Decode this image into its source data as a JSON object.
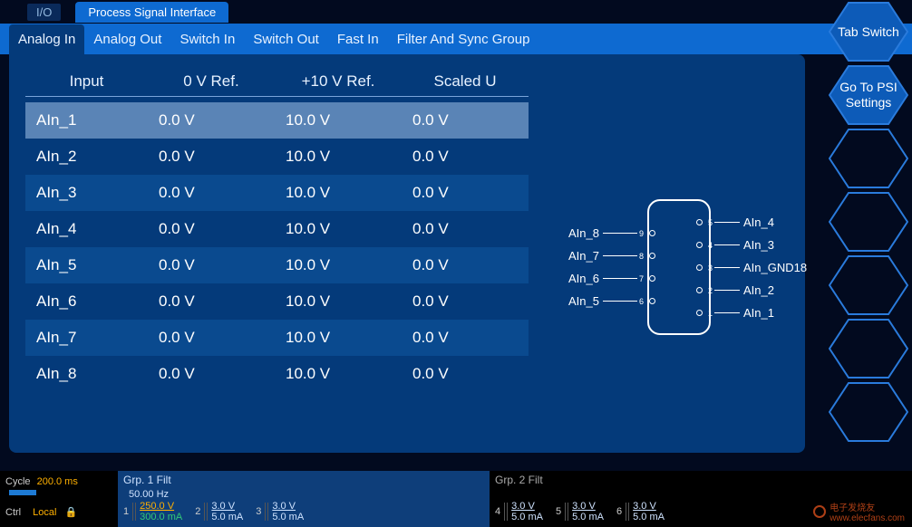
{
  "topstrip": {
    "mini": "I/O",
    "main": "Process Signal Interface"
  },
  "tabs": [
    "Analog In",
    "Analog Out",
    "Switch In",
    "Switch Out",
    "Fast In",
    "Filter And Sync Group"
  ],
  "tabs_active_index": 0,
  "table": {
    "headers": [
      "Input",
      "0 V Ref.",
      "+10 V Ref.",
      "Scaled U"
    ],
    "rows": [
      {
        "input": "AIn_1",
        "ref0": "0.0 V",
        "ref10": "10.0 V",
        "scaled": "0.0 V",
        "selected": true
      },
      {
        "input": "AIn_2",
        "ref0": "0.0 V",
        "ref10": "10.0 V",
        "scaled": "0.0 V",
        "selected": false
      },
      {
        "input": "AIn_3",
        "ref0": "0.0 V",
        "ref10": "10.0 V",
        "scaled": "0.0 V",
        "selected": false
      },
      {
        "input": "AIn_4",
        "ref0": "0.0 V",
        "ref10": "10.0 V",
        "scaled": "0.0 V",
        "selected": false
      },
      {
        "input": "AIn_5",
        "ref0": "0.0 V",
        "ref10": "10.0 V",
        "scaled": "0.0 V",
        "selected": false
      },
      {
        "input": "AIn_6",
        "ref0": "0.0 V",
        "ref10": "10.0 V",
        "scaled": "0.0 V",
        "selected": false
      },
      {
        "input": "AIn_7",
        "ref0": "0.0 V",
        "ref10": "10.0 V",
        "scaled": "0.0 V",
        "selected": false
      },
      {
        "input": "AIn_8",
        "ref0": "0.0 V",
        "ref10": "10.0 V",
        "scaled": "0.0 V",
        "selected": false
      }
    ]
  },
  "connector": {
    "left": [
      {
        "label": "AIn_8",
        "num": "9"
      },
      {
        "label": "AIn_7",
        "num": "8"
      },
      {
        "label": "AIn_6",
        "num": "7"
      },
      {
        "label": "AIn_5",
        "num": "6"
      }
    ],
    "right": [
      {
        "label": "AIn_4",
        "num": "5"
      },
      {
        "label": "AIn_3",
        "num": "4"
      },
      {
        "label": "AIn_GND18",
        "num": "3"
      },
      {
        "label": "AIn_2",
        "num": "2"
      },
      {
        "label": "AIn_1",
        "num": "1"
      }
    ]
  },
  "hex_buttons": [
    "Tab Switch",
    "Go To PSI Settings",
    "",
    "",
    "",
    "",
    ""
  ],
  "bottom": {
    "cycle_label": "Cycle",
    "cycle_value": "200.0 ms",
    "ctrl_label": "Ctrl",
    "ctrl_value": "Local",
    "grp1_title": "Grp. 1 Filt",
    "grp1_freq": "50.00   Hz",
    "grp2_title": "Grp. 2 Filt",
    "ch1": {
      "v1": "250.0 V",
      "v2": "300.0 mA"
    },
    "ch_template": {
      "v1": "3.0 V",
      "v2": "5.0 mA"
    }
  },
  "watermark": "www.elecfans.com"
}
